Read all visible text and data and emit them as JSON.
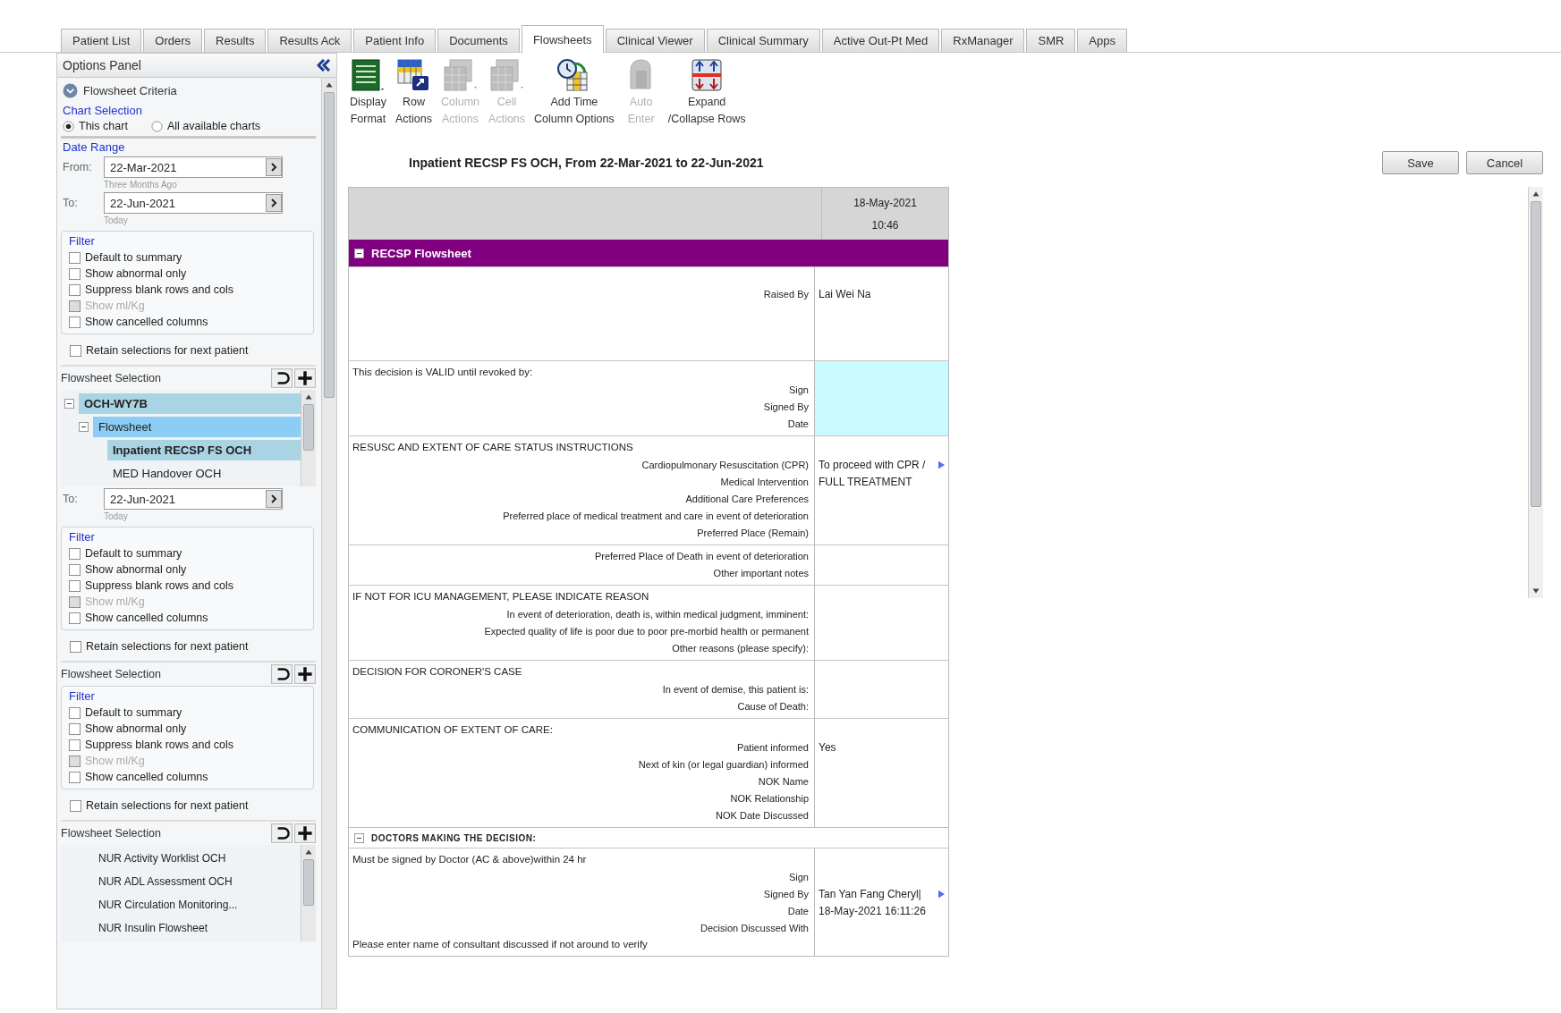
{
  "tabs": [
    {
      "label": "Patient List",
      "selected": false
    },
    {
      "label": "Orders",
      "selected": false
    },
    {
      "label": "Results",
      "selected": false
    },
    {
      "label": "Results Ack",
      "selected": false
    },
    {
      "label": "Patient Info",
      "selected": false
    },
    {
      "label": "Documents",
      "selected": false
    },
    {
      "label": "Flowsheets",
      "selected": true
    },
    {
      "label": "Clinical Viewer",
      "selected": false
    },
    {
      "label": "Clinical Summary",
      "selected": false
    },
    {
      "label": "Active Out-Pt Med",
      "selected": false
    },
    {
      "label": "RxManager",
      "selected": false
    },
    {
      "label": "SMR",
      "selected": false
    },
    {
      "label": "Apps",
      "selected": false
    }
  ],
  "options_panel": {
    "title": "Options Panel",
    "blocks": [
      {
        "kind": "header",
        "label": "Flowsheet Criteria"
      },
      {
        "kind": "radio_group",
        "title": "Chart Selection",
        "options": [
          {
            "label": "This chart",
            "selected": true
          },
          {
            "label": "All available charts",
            "selected": false
          }
        ]
      },
      {
        "kind": "date_range",
        "title": "Date Range",
        "fields": [
          {
            "label": "From:",
            "value": "22-Mar-2021",
            "hint": "Three Months Ago"
          },
          {
            "label": "To:",
            "value": "22-Jun-2021",
            "hint": "Today"
          }
        ]
      },
      {
        "kind": "filter",
        "title": "Filter",
        "options": [
          {
            "label": "Default to summary",
            "checked": false,
            "disabled": false
          },
          {
            "label": "Show abnormal only",
            "checked": false,
            "disabled": false
          },
          {
            "label": "Suppress blank rows and cols",
            "checked": false,
            "disabled": false
          },
          {
            "label": "Show ml/Kg",
            "checked": false,
            "disabled": true
          },
          {
            "label": "Show cancelled columns",
            "checked": false,
            "disabled": false
          }
        ]
      },
      {
        "kind": "retain",
        "label": "Retain selections for next patient",
        "checked": false
      },
      {
        "kind": "selection",
        "title": "Flowsheet Selection",
        "items": [
          {
            "label": "OCH-WY7B",
            "selected": true,
            "expanded": true,
            "children": [
              {
                "label": "Flowsheet",
                "selected": true,
                "expanded": true,
                "children": [
                  {
                    "label": "Inpatient RECSP FS OCH",
                    "selected": true
                  },
                  {
                    "label": "MED Handover OCH",
                    "selected": false
                  }
                ]
              }
            ]
          }
        ]
      },
      {
        "kind": "date_range",
        "fields": [
          {
            "label": "To:",
            "value": "22-Jun-2021",
            "hint": "Today"
          }
        ]
      },
      {
        "kind": "filter",
        "title": "Filter",
        "options": [
          {
            "label": "Default to summary",
            "checked": false,
            "disabled": false
          },
          {
            "label": "Show abnormal only",
            "checked": false,
            "disabled": false
          },
          {
            "label": "Suppress blank rows and cols",
            "checked": false,
            "disabled": false
          },
          {
            "label": "Show ml/Kg",
            "checked": false,
            "disabled": true
          },
          {
            "label": "Show cancelled columns",
            "checked": false,
            "disabled": false
          }
        ]
      },
      {
        "kind": "retain",
        "label": "Retain selections for next patient",
        "checked": false
      },
      {
        "kind": "selection",
        "title": "Flowsheet Selection"
      },
      {
        "kind": "filter",
        "title": "Filter",
        "options": [
          {
            "label": "Default to summary",
            "checked": false,
            "disabled": false
          },
          {
            "label": "Show abnormal only",
            "checked": false,
            "disabled": false
          },
          {
            "label": "Suppress blank rows and cols",
            "checked": false,
            "disabled": false
          },
          {
            "label": "Show ml/Kg",
            "checked": false,
            "disabled": true
          },
          {
            "label": "Show cancelled columns",
            "checked": false,
            "disabled": false
          }
        ]
      },
      {
        "kind": "retain",
        "label": "Retain selections for next patient",
        "checked": false
      },
      {
        "kind": "selection",
        "title": "Flowsheet Selection",
        "items": [
          {
            "label": "NUR Activity Worklist OCH",
            "selected": false
          },
          {
            "label": "NUR ADL Assessment OCH",
            "selected": false
          },
          {
            "label": "NUR Circulation Monitoring...",
            "selected": false
          },
          {
            "label": "NUR Insulin Flowsheet",
            "selected": false
          }
        ]
      }
    ]
  },
  "toolbar": [
    {
      "kind": "display",
      "label": [
        "Display",
        "Format"
      ],
      "disabled": false
    },
    {
      "kind": "row",
      "label": [
        "Row",
        "Actions"
      ],
      "disabled": false
    },
    {
      "kind": "column",
      "label": [
        "Column",
        "Actions"
      ],
      "disabled": true
    },
    {
      "kind": "cell",
      "label": [
        "Cell",
        "Actions"
      ],
      "disabled": true
    },
    {
      "kind": "time",
      "label": [
        "Add Time",
        "Column Options"
      ],
      "disabled": false
    },
    {
      "kind": "auto",
      "label": [
        "Auto",
        "Enter"
      ],
      "disabled": true
    },
    {
      "kind": "expand",
      "label": [
        "Expand",
        "/Collapse Rows"
      ],
      "disabled": false
    }
  ],
  "chart_title": "Inpatient RECSP FS OCH, From 22-Mar-2021 to 22-Jun-2021",
  "buttons": [
    "Save",
    "Cancel"
  ],
  "grid": {
    "column": {
      "date": "18-May-2021",
      "time": "10:46"
    },
    "sections": [
      {
        "kind": "band",
        "title": "RECSP Flowsheet",
        "expanded": true,
        "blocks": [
          {
            "highlighted": false,
            "rows": [
              {
                "label": "Raised By",
                "value": "Lai Wei Na"
              }
            ]
          },
          {
            "heading": "This decision is VALID until revoked by:",
            "highlighted": true,
            "rows": [
              {
                "label": "Sign",
                "more": false
              },
              {
                "label": "Signed By",
                "more": false
              },
              {
                "label": "Date",
                "more": false
              }
            ]
          },
          {
            "heading": "RESUSC AND EXTENT OF CARE STATUS INSTRUCTIONS",
            "highlighted": false,
            "rows": [
              {
                "label": "Cardiopulmonary Resuscitation (CPR)",
                "value": "To proceed with CPR /",
                "more": true
              },
              {
                "label": "Medical Intervention",
                "value": "FULL TREATMENT"
              },
              {
                "label": "Additional Care Preferences",
                "more": false
              },
              {
                "label": "Preferred place of medical treatment and care in event of deterioration",
                "more": false
              },
              {
                "label": "Preferred Place (Remain)",
                "more": false
              }
            ]
          },
          {
            "highlighted": false,
            "rows": [
              {
                "label": "Preferred Place of Death in event of deterioration",
                "more": false
              },
              {
                "label": "Other important notes",
                "more": false
              }
            ]
          },
          {
            "heading": "IF NOT FOR ICU MANAGEMENT, PLEASE INDICATE REASON",
            "highlighted": false,
            "rows": [
              {
                "label": "In event of deterioration, death is, within medical judgment, imminent:",
                "more": false
              },
              {
                "label": "Expected quality of life is poor due to poor pre-morbid health or permanent",
                "more": false
              },
              {
                "label": "Other reasons (please specify):",
                "more": false
              }
            ]
          },
          {
            "heading": "DECISION FOR CORONER'S CASE",
            "highlighted": false,
            "rows": [
              {
                "label": "In event of demise, this patient is:",
                "more": false
              },
              {
                "label": "Cause of Death:",
                "more": false
              }
            ]
          },
          {
            "heading": "COMMUNICATION OF EXTENT OF CARE:",
            "highlighted": false,
            "rows": [
              {
                "label": "Patient informed",
                "value": "Yes"
              },
              {
                "label": "Next of kin (or legal guardian) informed",
                "more": false
              },
              {
                "label": "NOK Name",
                "more": false
              },
              {
                "label": "NOK Relationship",
                "more": false
              },
              {
                "label": "NOK Date Discussed",
                "more": false
              }
            ]
          }
        ]
      },
      {
        "kind": "plain",
        "title": "DOCTORS MAKING THE DECISION:",
        "expanded": true,
        "blocks": [
          {
            "heading": "Must be signed by Doctor (AC & above)within 24 hr",
            "highlighted": false,
            "rows": [
              {
                "label": "Sign",
                "more": false
              },
              {
                "label": "Signed By",
                "value": "Tan Yan Fang Cheryl|",
                "more": true
              },
              {
                "label": "Date",
                "value": "18-May-2021 16:11:26"
              },
              {
                "label": "Decision Discussed With",
                "more": false
              }
            ],
            "note": "Please enter name of consultant discussed if not around to verify"
          }
        ]
      }
    ]
  }
}
